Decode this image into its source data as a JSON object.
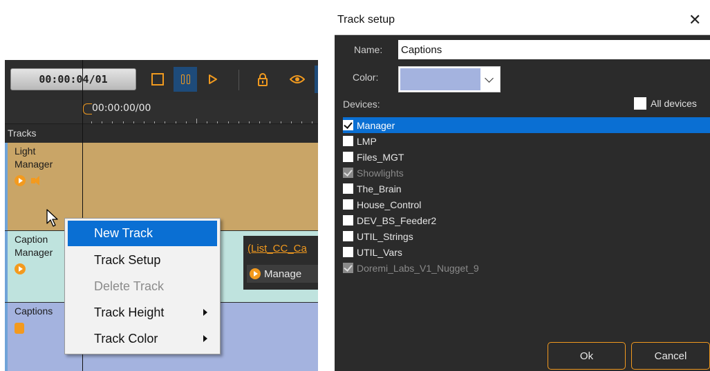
{
  "timeline": {
    "timecode": "00:00:04/01",
    "ruler_start": "00:00:00/00",
    "tracks_header": "Tracks",
    "tracks": [
      {
        "name_line1": "Light",
        "name_line2": "Manager",
        "color": "#c9a567"
      },
      {
        "name_line1": "Caption",
        "name_line2": "Manager",
        "color": "#bfe3de"
      },
      {
        "name_line1": "Captions",
        "name_line2": "",
        "color": "#a4b3df"
      }
    ],
    "clip": {
      "title": "(List_CC_Ca",
      "subtitle": "Manage"
    }
  },
  "context_menu": {
    "items": [
      {
        "label": "New Track",
        "state": "selected"
      },
      {
        "label": "Track Setup",
        "state": "normal"
      },
      {
        "label": "Delete Track",
        "state": "disabled"
      },
      {
        "label": "Track Height",
        "state": "submenu"
      },
      {
        "label": "Track Color",
        "state": "submenu"
      }
    ]
  },
  "dialog": {
    "title": "Track setup",
    "close_glyph": "✕",
    "name_label": "Name:",
    "name_value": "Captions",
    "color_label": "Color:",
    "color_value": "#a4b3df",
    "devices_label": "Devices:",
    "all_devices_label": "All devices",
    "devices": [
      {
        "label": "Manager",
        "checked": true,
        "selected": true,
        "disabled": false
      },
      {
        "label": "LMP",
        "checked": false,
        "selected": false,
        "disabled": false
      },
      {
        "label": "Files_MGT",
        "checked": false,
        "selected": false,
        "disabled": false
      },
      {
        "label": "Showlights",
        "checked": true,
        "selected": false,
        "disabled": true
      },
      {
        "label": "The_Brain",
        "checked": false,
        "selected": false,
        "disabled": false
      },
      {
        "label": "House_Control",
        "checked": false,
        "selected": false,
        "disabled": false
      },
      {
        "label": "DEV_BS_Feeder2",
        "checked": false,
        "selected": false,
        "disabled": false
      },
      {
        "label": "UTIL_Strings",
        "checked": false,
        "selected": false,
        "disabled": false
      },
      {
        "label": "UTIL_Vars",
        "checked": false,
        "selected": false,
        "disabled": false
      },
      {
        "label": "Doremi_Labs_V1_Nugget_9",
        "checked": true,
        "selected": false,
        "disabled": true
      }
    ],
    "ok_label": "Ok",
    "cancel_label": "Cancel"
  },
  "colors": {
    "accent": "#f39a1e",
    "selection": "#0a6fd3"
  }
}
